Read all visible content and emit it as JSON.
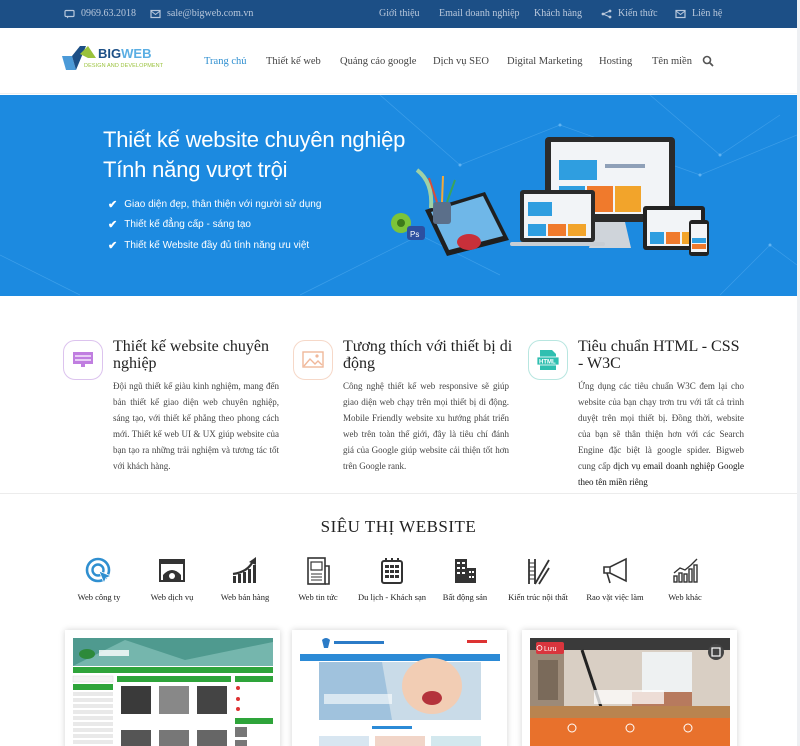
{
  "topbar": {
    "phone": "0969.63.2018",
    "email": "sale@bigweb.com.vn",
    "links": [
      {
        "label": "Giới thiệu"
      },
      {
        "label": "Email doanh nghiệp"
      },
      {
        "label": "Khách hàng"
      },
      {
        "label": "Kiến thức",
        "icon": "share-icon"
      },
      {
        "label": "Liên hệ",
        "icon": "mail-icon"
      }
    ],
    "bg_color": "#1c4f86"
  },
  "logo": {
    "part1": "BIG",
    "part2": "WEB",
    "tagline": "DESIGN AND DEVELOPMENT"
  },
  "nav": {
    "items": [
      {
        "label": "Trang chủ",
        "active": true
      },
      {
        "label": "Thiết kế web"
      },
      {
        "label": "Quảng cáo google"
      },
      {
        "label": "Dịch vụ SEO"
      },
      {
        "label": "Digital Marketing"
      },
      {
        "label": "Hosting"
      },
      {
        "label": "Tên miền"
      }
    ],
    "search_icon": "search-icon",
    "active_color": "#2f8fd0"
  },
  "hero": {
    "title_line1": "Thiết kế website chuyên nghiệp",
    "title_line2": "Tính năng vượt trội",
    "bullets": [
      "Giao diện đẹp, thân thiện với người sử dụng",
      "Thiết kế đẳng cấp - sáng tạo",
      "Thiết kế Website đầy đủ tính năng ưu việt"
    ],
    "bg_color": "#1c8ae0"
  },
  "features": [
    {
      "title": "Thiết kế website chuyên nghiệp",
      "text": "Đội ngũ thiết kế giàu kinh nghiệm, mang đến bản thiết kế giao diện web chuyên nghiệp, sáng tạo, với thiết kế phẳng theo phong cách mới. Thiết kế web UI & UX giúp website của bạn tạo ra những trải nghiệm và tương tác tốt với khách hàng.",
      "icon": "monitor-icon",
      "color": "#c07ee0"
    },
    {
      "title": "Tương thích với thiết bị di động",
      "text": "Công nghệ thiết kế web responsive sẽ giúp giao diện web chạy trên mọi thiết bị di động. Mobile Friendly website xu hướng phát triển web trên toàn thế giới, đây là tiêu chí đánh giá của Google giúp website cải thiện tốt hơn trên Google rank.",
      "icon": "image-icon",
      "color": "#f0b89a"
    },
    {
      "title": "Tiêu chuẩn HTML - CSS - W3C",
      "text": "Ứng dụng các tiêu chuẩn W3C đem lại cho website của bạn chạy trơn tru với tất cả trình duyệt trên mọi thiết bị. Đồng thời, website của bạn sẽ thân thiện hơn với các Search Engine đặc biệt là google spider. Bigweb cung cấp ",
      "link": "dịch vụ email doanh nghiệp Google theo tên miền riêng",
      "icon": "html-file-icon",
      "color": "#2fbfb0"
    }
  ],
  "market": {
    "title": "SIÊU THỊ WEBSITE",
    "categories": [
      {
        "label": "Web công ty",
        "icon": "target-icon"
      },
      {
        "label": "Web dịch vụ",
        "icon": "browser-gear-icon"
      },
      {
        "label": "Web bán hàng",
        "icon": "growth-chart-icon"
      },
      {
        "label": "Web tin tức",
        "icon": "newspaper-icon"
      },
      {
        "label": "Du lịch - Khách sạn",
        "icon": "hotel-icon"
      },
      {
        "label": "Bất động sản",
        "icon": "buildings-icon"
      },
      {
        "label": "Kiến trúc nội thất",
        "icon": "stairs-icon"
      },
      {
        "label": "Rao vặt việc làm",
        "icon": "megaphone-icon"
      },
      {
        "label": "Web khác",
        "icon": "bar-chart-icon"
      }
    ],
    "templates": [
      {
        "name": "steel-pipe-template"
      },
      {
        "name": "dental-clinic-template"
      },
      {
        "name": "interior-design-template",
        "badge": "Lưu"
      }
    ]
  }
}
